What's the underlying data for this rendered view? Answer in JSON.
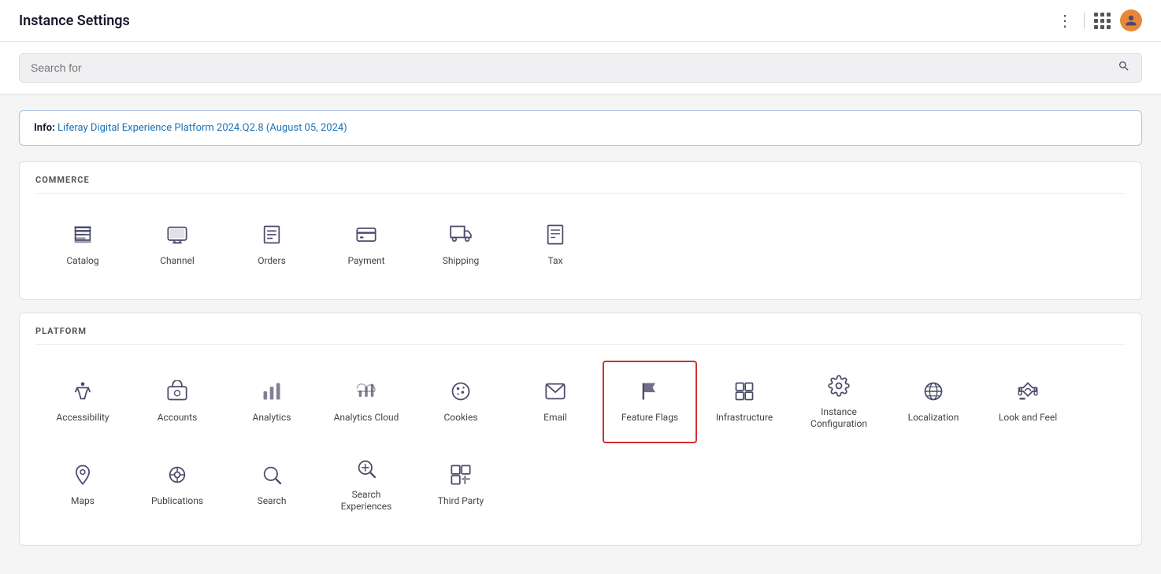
{
  "topbar": {
    "title": "Instance Settings",
    "dots_label": "⋮",
    "avatar_letter": "👤"
  },
  "search": {
    "placeholder": "Search for"
  },
  "info": {
    "label": "Info:",
    "text": "Liferay Digital Experience Platform 2024.Q2.8 (August 05, 2024)"
  },
  "sections": [
    {
      "id": "commerce",
      "title": "COMMERCE",
      "items": [
        {
          "id": "catalog",
          "label": "Catalog",
          "icon": "catalog"
        },
        {
          "id": "channel",
          "label": "Channel",
          "icon": "channel"
        },
        {
          "id": "orders",
          "label": "Orders",
          "icon": "orders"
        },
        {
          "id": "payment",
          "label": "Payment",
          "icon": "payment"
        },
        {
          "id": "shipping",
          "label": "Shipping",
          "icon": "shipping"
        },
        {
          "id": "tax",
          "label": "Tax",
          "icon": "tax"
        }
      ]
    },
    {
      "id": "platform",
      "title": "PLATFORM",
      "items": [
        {
          "id": "accessibility",
          "label": "Accessibility",
          "icon": "accessibility"
        },
        {
          "id": "accounts",
          "label": "Accounts",
          "icon": "accounts"
        },
        {
          "id": "analytics",
          "label": "Analytics",
          "icon": "analytics"
        },
        {
          "id": "analytics-cloud",
          "label": "Analytics Cloud",
          "icon": "analytics-cloud"
        },
        {
          "id": "cookies",
          "label": "Cookies",
          "icon": "cookies"
        },
        {
          "id": "email",
          "label": "Email",
          "icon": "email"
        },
        {
          "id": "feature-flags",
          "label": "Feature Flags",
          "icon": "feature-flags",
          "selected": true
        },
        {
          "id": "infrastructure",
          "label": "Infrastructure",
          "icon": "infrastructure"
        },
        {
          "id": "instance-configuration",
          "label": "Instance\nConfiguration",
          "icon": "instance-configuration"
        },
        {
          "id": "localization",
          "label": "Localization",
          "icon": "localization"
        },
        {
          "id": "look-and-feel",
          "label": "Look and Feel",
          "icon": "look-and-feel"
        },
        {
          "id": "maps",
          "label": "Maps",
          "icon": "maps"
        },
        {
          "id": "publications",
          "label": "Publications",
          "icon": "publications"
        },
        {
          "id": "search",
          "label": "Search",
          "icon": "search"
        },
        {
          "id": "search-experiences",
          "label": "Search Experiences",
          "icon": "search-experiences"
        },
        {
          "id": "third-party",
          "label": "Third Party",
          "icon": "third-party"
        }
      ]
    }
  ]
}
